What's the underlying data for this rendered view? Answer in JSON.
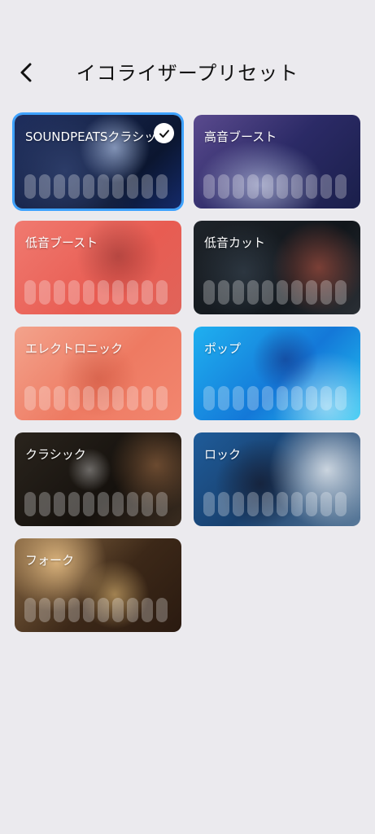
{
  "header": {
    "title": "イコライザープリセット"
  },
  "presets": [
    {
      "label": "SOUNDPEATSクラシック",
      "selected": true,
      "scene": "classic-s"
    },
    {
      "label": "高音ブースト",
      "selected": false,
      "scene": "treble"
    },
    {
      "label": "低音ブースト",
      "selected": false,
      "scene": "bass"
    },
    {
      "label": "低音カット",
      "selected": false,
      "scene": "bass-cut"
    },
    {
      "label": "エレクトロニック",
      "selected": false,
      "scene": "electronic"
    },
    {
      "label": "ポップ",
      "selected": false,
      "scene": "pop"
    },
    {
      "label": "クラシック",
      "selected": false,
      "scene": "classical"
    },
    {
      "label": "ロック",
      "selected": false,
      "scene": "rock"
    },
    {
      "label": "フォーク",
      "selected": false,
      "scene": "folk"
    }
  ],
  "colors": {
    "background": "#ebeaee",
    "selected_outline": "#3ea2ff"
  }
}
